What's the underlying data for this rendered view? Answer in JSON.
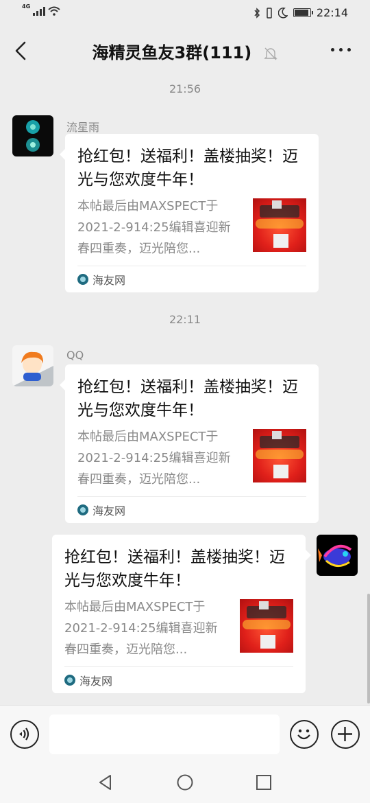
{
  "status_bar": {
    "network": "4G",
    "time": "22:14"
  },
  "header": {
    "title": "海精灵鱼友3群(111)"
  },
  "messages": [
    {
      "timestamp": "21:56",
      "sender": "流星雨",
      "card": {
        "title": "抢红包！送福利！盖楼抽奖！迈光与您欢度牛年！",
        "desc": "本帖最后由MAXSPECT于2021-2-914:25编辑喜迎新春四重奏，迈光陪您...",
        "source": "海友网"
      }
    },
    {
      "timestamp": "22:11",
      "sender": "QQ",
      "card": {
        "title": "抢红包！送福利！盖楼抽奖！迈光与您欢度牛年！",
        "desc": "本帖最后由MAXSPECT于2021-2-914:25编辑喜迎新春四重奏，迈光陪您...",
        "source": "海友网"
      }
    },
    {
      "card": {
        "title": "抢红包！送福利！盖楼抽奖！迈光与您欢度牛年！",
        "desc": "本帖最后由MAXSPECT于2021-2-914:25编辑喜迎新春四重奏，迈光陪您...",
        "source": "海友网"
      }
    }
  ],
  "input_bar": {
    "voice_icon": "voice-icon",
    "emoji_icon": "emoji-icon",
    "plus_icon": "plus-icon",
    "message_value": ""
  },
  "nav_bar": {
    "icons": [
      "back-triangle-icon",
      "home-circle-icon",
      "recents-square-icon"
    ]
  },
  "colors": {
    "background": "#ededed",
    "bubble": "#ffffff",
    "meta_text": "#888888",
    "thumb_red": "#e0201a"
  }
}
